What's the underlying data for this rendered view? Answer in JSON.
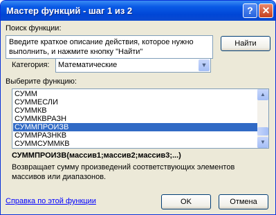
{
  "window": {
    "title": "Мастер функций - шаг 1 из 2",
    "help_button": "?",
    "close_button": "✕"
  },
  "search": {
    "label": "Поиск функции:",
    "description": "Введите краткое описание действия, которое нужно выполнить, и нажмите кнопку \"Найти\"",
    "find_button": "Найти"
  },
  "category": {
    "label": "Категория:",
    "selected": "Математические"
  },
  "function_list": {
    "label": "Выберите функцию:",
    "items": [
      {
        "name": "СУММ",
        "selected": false
      },
      {
        "name": "СУММЕСЛИ",
        "selected": false
      },
      {
        "name": "СУММКВ",
        "selected": false
      },
      {
        "name": "СУММКВРАЗН",
        "selected": false
      },
      {
        "name": "СУММПРОИЗВ",
        "selected": true
      },
      {
        "name": "СУММРАЗНКВ",
        "selected": false
      },
      {
        "name": "СУММСУММКВ",
        "selected": false
      }
    ]
  },
  "signature": "СУММПРОИЗВ(массив1;массив2;массив3;...)",
  "function_description": "Возвращает сумму произведений соответствующих элементов массивов или диапазонов.",
  "footer": {
    "help_link": "Справка по этой функции",
    "ok": "OK",
    "cancel": "Отмена"
  }
}
